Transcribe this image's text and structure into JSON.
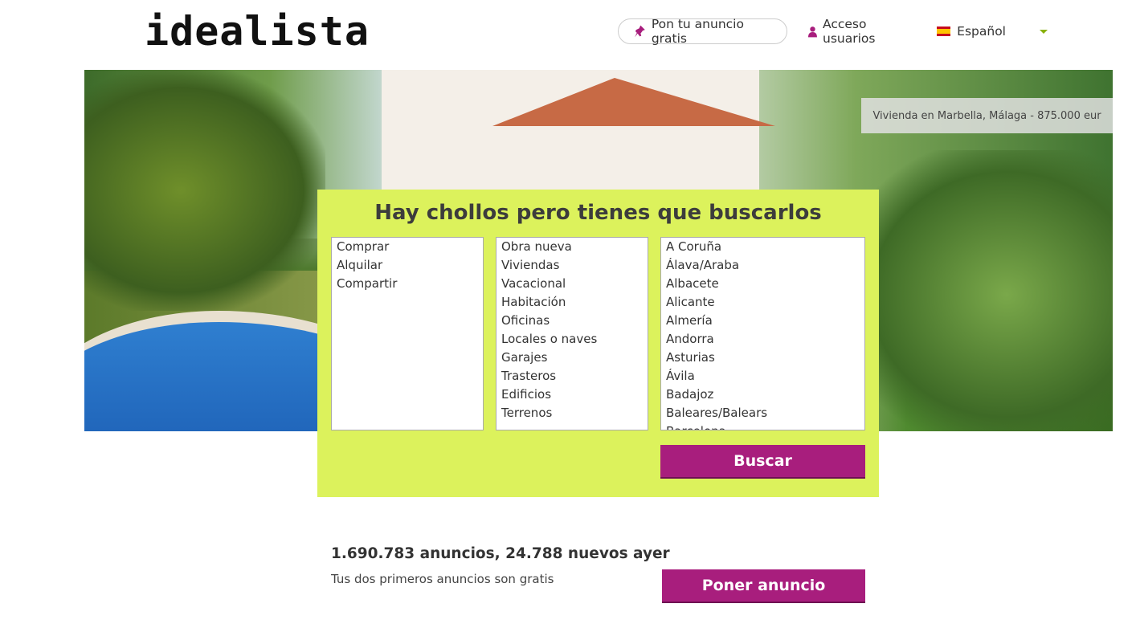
{
  "brand": {
    "logo_text": "idealista"
  },
  "topnav": {
    "post_ad_label": "Pon tu anuncio gratis",
    "login_label": "Acceso usuarios",
    "language_label": "Español"
  },
  "hero": {
    "caption": "Vivienda en Marbella, Málaga - 875.000 eur"
  },
  "search": {
    "heading": "Hay chollos pero tienes que buscarlos",
    "operation_options": [
      "Comprar",
      "Alquilar",
      "Compartir"
    ],
    "type_options": [
      "Obra nueva",
      "Viviendas",
      "Vacacional",
      "Habitación",
      "Oficinas",
      "Locales o naves",
      "Garajes",
      "Trasteros",
      "Edificios",
      "Terrenos"
    ],
    "location_options": [
      "A Coruña",
      "Álava/Araba",
      "Albacete",
      "Alicante",
      "Almería",
      "Andorra",
      "Asturias",
      "Ávila",
      "Badajoz",
      "Baleares/Balears",
      "Barcelona"
    ],
    "search_button": "Buscar"
  },
  "stats": {
    "headline": "1.690.783 anuncios, 24.788 nuevos ayer",
    "subline": "Tus dos primeros anuncios son gratis",
    "cta_button": "Poner anuncio"
  },
  "colors": {
    "accent": "#a81e7d",
    "search_bg": "#dcf25c",
    "caret": "#8ab10c"
  }
}
